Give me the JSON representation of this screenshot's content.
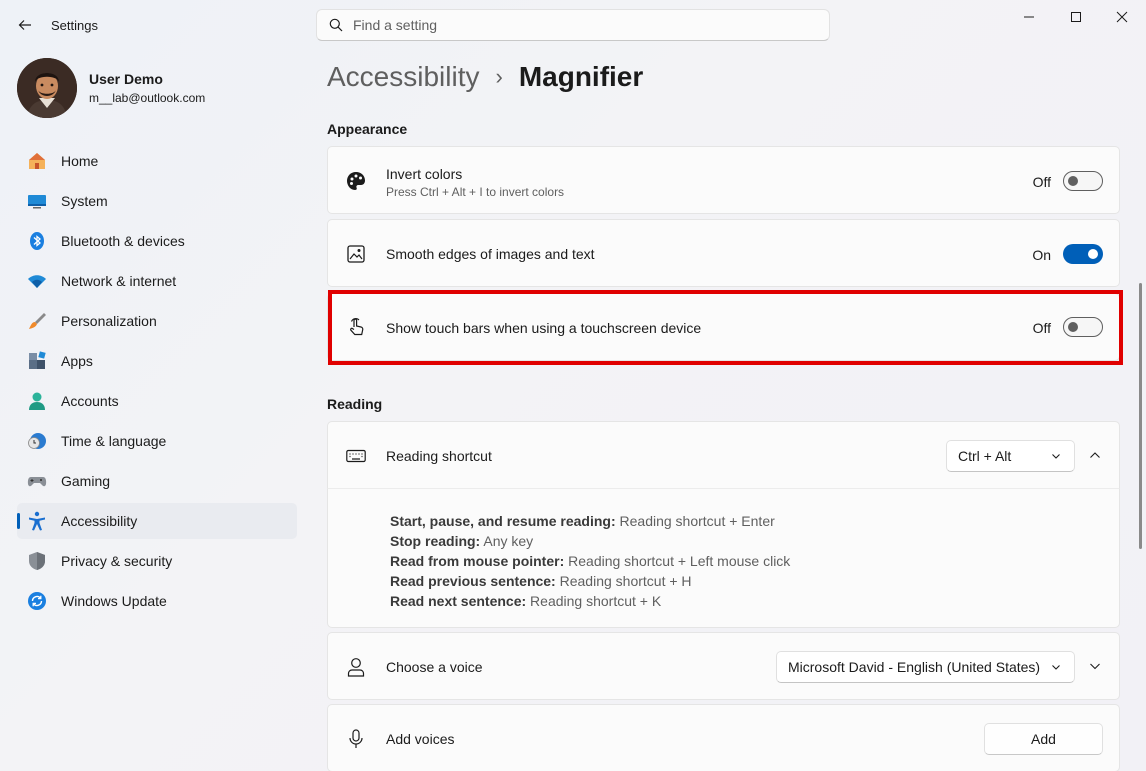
{
  "window": {
    "app_title": "Settings",
    "minimize_label": "Minimize",
    "maximize_label": "Maximize",
    "close_label": "Close"
  },
  "search": {
    "placeholder": "Find a setting",
    "value": ""
  },
  "profile": {
    "name": "User Demo",
    "email": "m__lab@outlook.com"
  },
  "sidebar": {
    "items": [
      {
        "label": "Home",
        "icon": "home-icon"
      },
      {
        "label": "System",
        "icon": "system-icon"
      },
      {
        "label": "Bluetooth & devices",
        "icon": "bluetooth-icon"
      },
      {
        "label": "Network & internet",
        "icon": "wifi-icon"
      },
      {
        "label": "Personalization",
        "icon": "brush-icon"
      },
      {
        "label": "Apps",
        "icon": "apps-icon"
      },
      {
        "label": "Accounts",
        "icon": "accounts-icon"
      },
      {
        "label": "Time & language",
        "icon": "clock-globe-icon"
      },
      {
        "label": "Gaming",
        "icon": "gamepad-icon"
      },
      {
        "label": "Accessibility",
        "icon": "accessibility-icon",
        "active": true
      },
      {
        "label": "Privacy & security",
        "icon": "shield-icon"
      },
      {
        "label": "Windows Update",
        "icon": "update-icon"
      }
    ]
  },
  "breadcrumb": {
    "parent": "Accessibility",
    "separator": "›",
    "current": "Magnifier"
  },
  "appearance": {
    "title": "Appearance",
    "invert_colors": {
      "title": "Invert colors",
      "desc": "Press Ctrl + Alt + I to invert colors",
      "state": "Off",
      "on": false
    },
    "smooth_edges": {
      "title": "Smooth edges of images and text",
      "state": "On",
      "on": true
    },
    "touch_bars": {
      "title": "Show touch bars when using a touchscreen device",
      "state": "Off",
      "on": false
    }
  },
  "reading": {
    "title": "Reading",
    "shortcut": {
      "title": "Reading shortcut",
      "value": "Ctrl + Alt",
      "lines": [
        {
          "key": "Start, pause, and resume reading:",
          "value": " Reading shortcut + Enter"
        },
        {
          "key": "Stop reading:",
          "value": " Any key"
        },
        {
          "key": "Read from mouse pointer:",
          "value": " Reading shortcut + Left mouse click"
        },
        {
          "key": "Read previous sentence:",
          "value": " Reading shortcut + H"
        },
        {
          "key": "Read next sentence:",
          "value": " Reading shortcut + K"
        }
      ]
    },
    "voice": {
      "title": "Choose a voice",
      "value": "Microsoft David - English (United States)"
    },
    "add_voices": {
      "title": "Add voices",
      "button": "Add"
    }
  },
  "colors": {
    "accent": "#005fb8",
    "highlight": "#e00000"
  }
}
